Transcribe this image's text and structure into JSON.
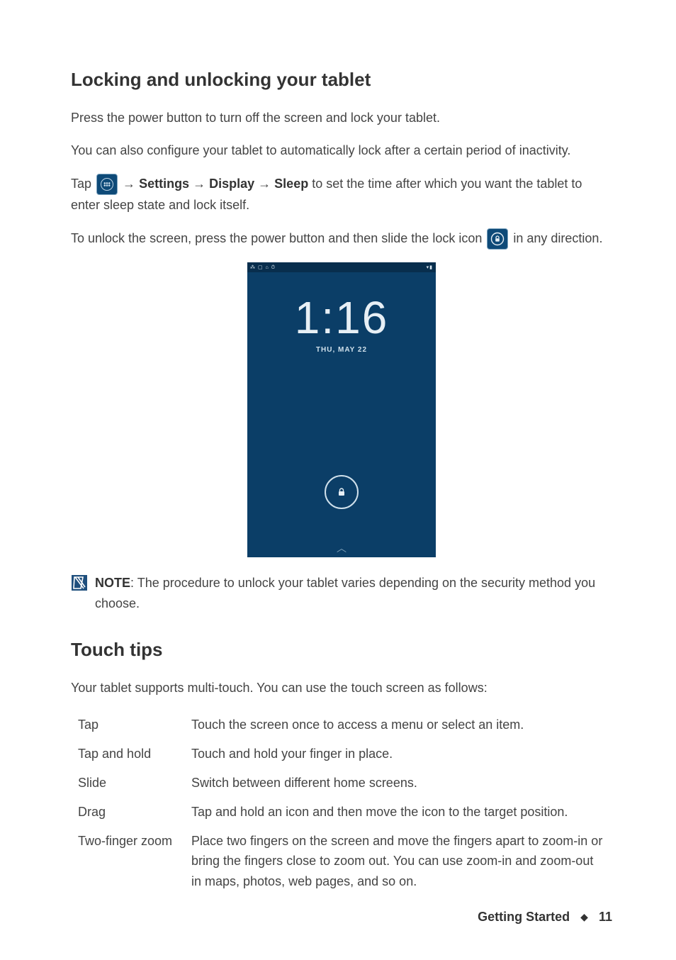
{
  "heading1": "Locking and unlocking your tablet",
  "para1": "Press the power button to turn off the screen and lock your tablet.",
  "para2": "You can also configure your tablet to automatically lock after a certain period of inactivity.",
  "tap_line": {
    "pre": "Tap ",
    "arrow1": " → ",
    "settings": "Settings",
    "arrow2": "→ ",
    "display": "Display",
    "arrow3": "→ ",
    "sleep": "Sleep",
    "post": " to set the time after which you want the tablet to enter sleep state and lock itself."
  },
  "unlock_line": {
    "pre": "To unlock the screen, press the power button and then slide the lock icon ",
    "post": " in any direction."
  },
  "lockscreen": {
    "status_left": "⁂ ▢ ⌂ ⏱",
    "status_right": "▾▮",
    "time": "1:16",
    "date": "THU, MAY 22"
  },
  "note": {
    "label": "NOTE",
    "text": ": The procedure to unlock your tablet varies depending on the security method you  choose."
  },
  "heading2": "Touch tips",
  "touch_intro": "Your tablet supports multi-touch. You can use the touch screen as follows:",
  "tips": [
    {
      "term": "Tap",
      "desc": "Touch the screen once to access a menu or select an item."
    },
    {
      "term": "Tap and hold",
      "desc": "Touch and hold your finger in place."
    },
    {
      "term": "Slide",
      "desc": "Switch between different home screens."
    },
    {
      "term": "Drag",
      "desc": "Tap and hold an icon and then move the icon to the target position."
    },
    {
      "term": "Two-finger zoom",
      "desc": "Place two fingers on the screen and move the fingers apart to zoom-in or bring the fingers close to zoom out. You can use zoom-in and zoom-out in maps, photos, web pages, and so on."
    }
  ],
  "footer": {
    "section": "Getting Started",
    "page": "11"
  }
}
